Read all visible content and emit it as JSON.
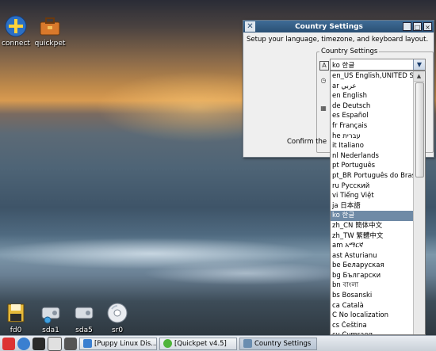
{
  "desktop": {
    "icons": [
      {
        "label": "connect"
      },
      {
        "label": "quickpet"
      },
      {
        "label": "fd0"
      },
      {
        "label": "sda1"
      },
      {
        "label": "sda5"
      },
      {
        "label": "sr0"
      }
    ]
  },
  "window": {
    "title": "Country Settings",
    "subtitle": "Setup your language, timezone, and keyboard layout.",
    "group_label": "Country Settings",
    "language_value": "ko 한글",
    "confirm_text": "Confirm the",
    "buttons": {
      "minimize": "_",
      "maximize": "□",
      "close": "×"
    }
  },
  "language_options": [
    "en_US English,UNITED STATES",
    "ar عربي",
    "en English",
    "de Deutsch",
    "es Español",
    "fr Français",
    "he עברית",
    "it Italiano",
    "nl Nederlands",
    "pt Português",
    "pt_BR Português do Brasil",
    "ru Русский",
    "vi Tiếng Việt",
    "ja 日本語",
    "ko 한글",
    "zh_CN 簡体中文",
    "zh_TW 繁體中文",
    "am አማርኛ",
    "ast Asturianu",
    "be Беларуская",
    "bg Български",
    "bn বাংলা",
    "bs Bosanski",
    "ca Català",
    "C No localization",
    "cs Čeština",
    "cy Cymraeg"
  ],
  "selected_index": 14,
  "taskbar": {
    "tasks": [
      {
        "label": "[Puppy Linux Dis..."
      },
      {
        "label": "[Quickpet v4.5]"
      },
      {
        "label": "Country Settings"
      }
    ]
  }
}
